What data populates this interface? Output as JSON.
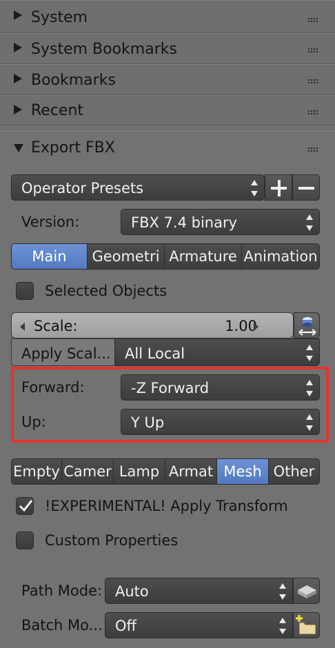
{
  "panels": {
    "system": "System",
    "system_bookmarks": "System Bookmarks",
    "bookmarks": "Bookmarks",
    "recent": "Recent",
    "export_fbx": "Export FBX"
  },
  "operator_presets": "Operator Presets",
  "version": {
    "label": "Version:",
    "value": "FBX 7.4 binary"
  },
  "main_tabs": [
    "Main",
    "Geometri",
    "Armature",
    "Animation"
  ],
  "main_tabs_active": "Main",
  "selected_objects": {
    "label": "Selected Objects",
    "checked": false
  },
  "scale": {
    "label": "Scale:",
    "value": "1.00"
  },
  "apply_scale": {
    "label": "Apply Scal...",
    "value": "All Local"
  },
  "forward": {
    "label": "Forward:",
    "value": "-Z Forward"
  },
  "up": {
    "label": "Up:",
    "value": "Y Up"
  },
  "object_types": [
    "Empty",
    "Camer",
    "Lamp",
    "Armat",
    "Mesh",
    "Other"
  ],
  "object_types_active": "Mesh",
  "apply_transform": {
    "label": "!EXPERIMENTAL! Apply Transform",
    "checked": true
  },
  "custom_properties": {
    "label": "Custom Properties",
    "checked": false
  },
  "path_mode": {
    "label": "Path Mode:",
    "value": "Auto"
  },
  "batch_mode": {
    "label": "Batch Mo...",
    "value": "Off"
  },
  "colors": {
    "active_tab": "#5a80c8",
    "highlight": "#e5342a"
  }
}
